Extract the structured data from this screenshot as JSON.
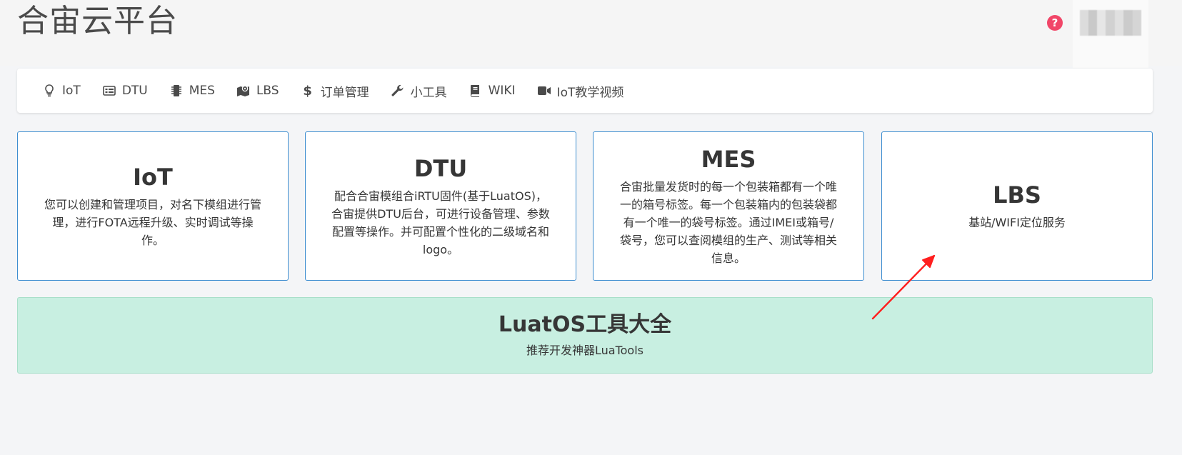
{
  "header": {
    "brand": "合宙云平台",
    "help_symbol": "?"
  },
  "nav": [
    {
      "label": "IoT",
      "icon": "lightbulb-icon"
    },
    {
      "label": "DTU",
      "icon": "list-card-icon"
    },
    {
      "label": "MES",
      "icon": "chip-icon"
    },
    {
      "label": "LBS",
      "icon": "map-pin-icon"
    },
    {
      "label": "订单管理",
      "icon": "dollar-icon"
    },
    {
      "label": "小工具",
      "icon": "wrench-icon"
    },
    {
      "label": "WIKI",
      "icon": "book-icon"
    },
    {
      "label": "IoT教学视频",
      "icon": "video-icon"
    }
  ],
  "cards": [
    {
      "title": "IoT",
      "desc": "您可以创建和管理项目，对名下模组进行管理，进行FOTA远程升级、实时调试等操作。"
    },
    {
      "title": "DTU",
      "desc": "配合合宙模组合iRTU固件(基于LuatOS)，合宙提供DTU后台，可进行设备管理、参数配置等操作。并可配置个性化的二级域名和logo。"
    },
    {
      "title": "MES",
      "desc": "合宙批量发货时的每一个包装箱都有一个唯一的箱号标签。每一个包装箱内的包装袋都有一个唯一的袋号标签。通过IMEI或箱号/袋号，您可以查阅模组的生产、测试等相关信息。"
    },
    {
      "title": "LBS",
      "desc": "基站/WIFI定位服务"
    }
  ],
  "banner": {
    "title": "LuatOS工具大全",
    "subtitle": "推荐开发神器LuaTools"
  },
  "colors": {
    "card_border": "#3e8ed0",
    "banner_bg": "#c8efe1",
    "help_red": "#f14668",
    "arrow_red": "#ff1f1f"
  }
}
